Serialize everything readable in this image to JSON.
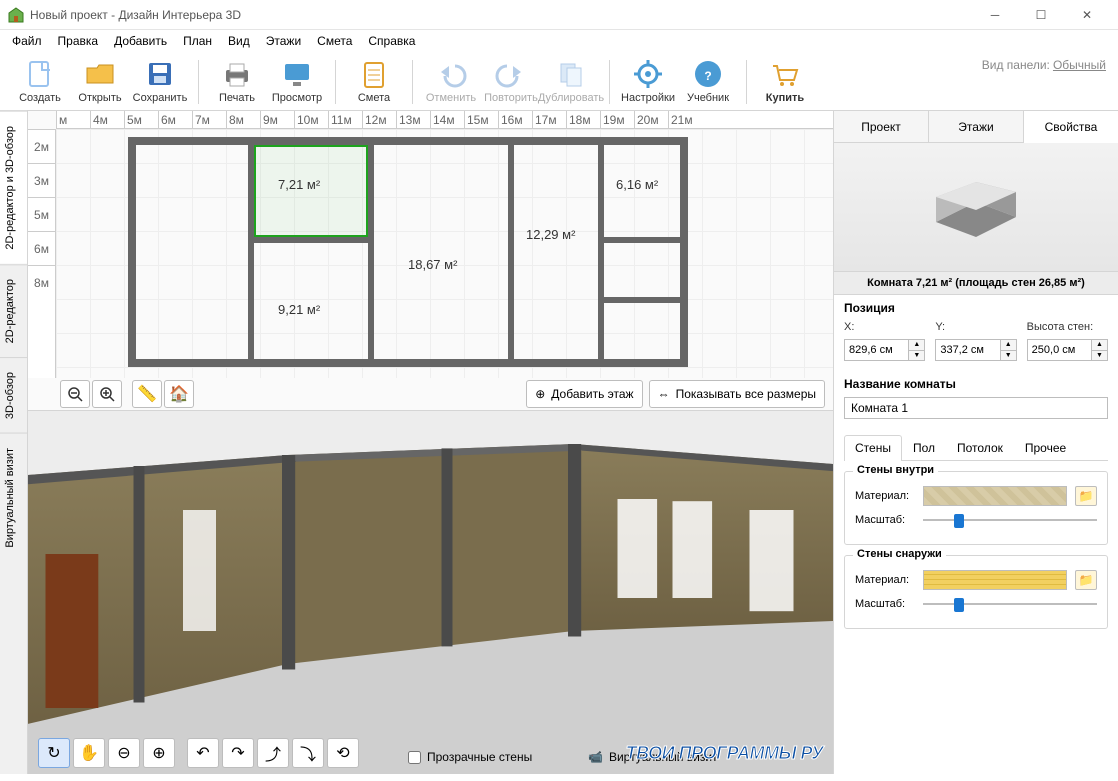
{
  "window": {
    "title": "Новый проект - Дизайн Интерьера 3D"
  },
  "menu": [
    "Файл",
    "Правка",
    "Добавить",
    "План",
    "Вид",
    "Этажи",
    "Смета",
    "Справка"
  ],
  "toolbar": {
    "create": "Создать",
    "open": "Открыть",
    "save": "Сохранить",
    "print": "Печать",
    "preview": "Просмотр",
    "estimate": "Смета",
    "undo": "Отменить",
    "redo": "Повторить",
    "duplicate": "Дублировать",
    "settings": "Настройки",
    "tutorial": "Учебник",
    "buy": "Купить",
    "panel_mode_label": "Вид панели:",
    "panel_mode_value": "Обычный"
  },
  "side_tabs": [
    "2D-редактор и 3D-обзор",
    "2D-редактор",
    "3D-обзор",
    "Виртуальный визит"
  ],
  "ruler_h": [
    "м",
    "4м",
    "5м",
    "6м",
    "7м",
    "8м",
    "9м",
    "10м",
    "11м",
    "12м",
    "13м",
    "14м",
    "15м",
    "16м",
    "17м",
    "18м",
    "19м",
    "20м",
    "21м"
  ],
  "ruler_v": [
    "2м",
    "3м",
    "5м",
    "6м",
    "8м"
  ],
  "rooms": {
    "r1": "7,21 м²",
    "r2": "6,16 м²",
    "r3": "12,29 м²",
    "r4": "18,67 м²",
    "r5": "9,21 м²"
  },
  "view2d_actions": {
    "add_floor": "Добавить этаж",
    "show_sizes": "Показывать все размеры"
  },
  "view3d": {
    "transparent_walls": "Прозрачные стены",
    "virtual_tour": "Виртуальный визит"
  },
  "watermark": "ТВОИ ПРОГРАММЫ РУ",
  "right_tabs": [
    "Проект",
    "Этажи",
    "Свойства"
  ],
  "info_bar": "Комната 7,21 м²  (площадь стен 26,85 м²)",
  "position": {
    "title": "Позиция",
    "x_label": "X:",
    "y_label": "Y:",
    "h_label": "Высота стен:",
    "x": "829,6 см",
    "y": "337,2 см",
    "h": "250,0 см"
  },
  "room_name": {
    "title": "Название комнаты",
    "value": "Комната 1"
  },
  "subtabs": [
    "Стены",
    "Пол",
    "Потолок",
    "Прочее"
  ],
  "walls_in": {
    "legend": "Стены внутри",
    "material": "Материал:",
    "scale": "Масштаб:"
  },
  "walls_out": {
    "legend": "Стены снаружи",
    "material": "Материал:",
    "scale": "Масштаб:"
  }
}
